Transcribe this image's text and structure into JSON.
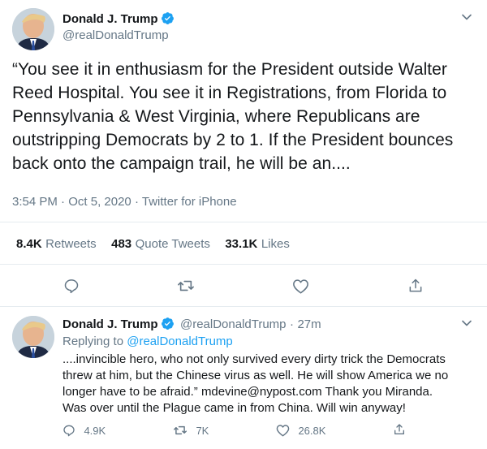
{
  "tweet": {
    "author_name": "Donald J. Trump",
    "author_handle": "@realDonaldTrump",
    "text_lines": [
      "“You see it in enthusiasm for the President outside Walter",
      "Reed Hospital. You see it in Registrations, from Florida to",
      "Pennsylvania & West Virginia, where Republicans are",
      "outstripping Democrats by 2 to 1. If the President bounces",
      "back onto the campaign trail, he will be an...."
    ],
    "time": "3:54 PM",
    "date": "Oct 5, 2020",
    "source": "Twitter for iPhone",
    "separator": "·",
    "stats": {
      "retweets_count": "8.4K",
      "retweets_label": "Retweets",
      "quotes_count": "483",
      "quotes_label": "Quote Tweets",
      "likes_count": "33.1K",
      "likes_label": "Likes"
    }
  },
  "reply": {
    "author_name": "Donald J. Trump",
    "author_handle": "@realDonaldTrump",
    "age": "27m",
    "separator": "·",
    "replying_prefix": "Replying to ",
    "replying_handle": "@realDonaldTrump",
    "text_lines": [
      "....invincible hero, who not only survived every dirty trick the Democrats",
      "threw at him, but the Chinese virus as well. He will show America we no",
      "longer have to be afraid.” mdevine@nypost.com  Thank you Miranda.",
      "Was over until the Plague came in from China. Will win anyway!"
    ],
    "reply_count": "4.9K",
    "retweet_count": "7K",
    "like_count": "26.8K"
  },
  "icons": [
    "verified-icon",
    "chevron-down-icon",
    "reply-icon",
    "retweet-icon",
    "like-icon",
    "share-icon"
  ],
  "colors": {
    "accent": "#1da1f2",
    "muted": "#657786",
    "divider": "#e6ecf0",
    "text": "#14171a"
  }
}
